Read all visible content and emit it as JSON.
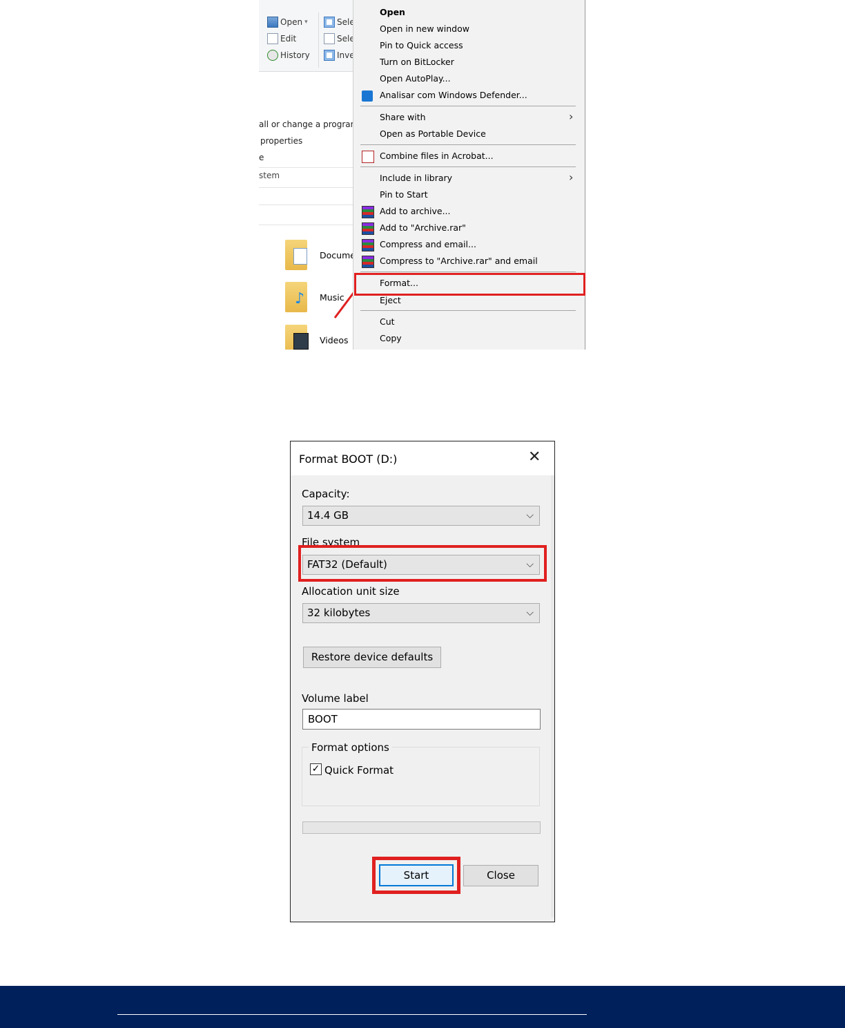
{
  "ribbon": {
    "open": "Open",
    "edit": "Edit",
    "history": "History",
    "select1": "Sele",
    "select2": "Sele",
    "invert": "Inve"
  },
  "left_links": [
    "all or change a program",
    "properties",
    "e",
    "stem"
  ],
  "folders": [
    {
      "name": "Docume",
      "icon": "documents-folder-icon"
    },
    {
      "name": "Music",
      "icon": "music-folder-icon"
    },
    {
      "name": "Videos",
      "icon": "videos-folder-icon"
    }
  ],
  "context_menu": {
    "open": "Open",
    "open_new_window": "Open in new window",
    "pin_quick": "Pin to Quick access",
    "bitlocker": "Turn on BitLocker",
    "autoplay": "Open AutoPlay...",
    "defender": "Analisar com Windows Defender...",
    "share_with": "Share with",
    "portable": "Open as Portable Device",
    "acrobat": "Combine files in Acrobat...",
    "include_library": "Include in library",
    "pin_start": "Pin to Start",
    "add_archive": "Add to archive...",
    "add_archive_rar": "Add to \"Archive.rar\"",
    "compress_email": "Compress and email...",
    "compress_rar_email": "Compress to \"Archive.rar\" and email",
    "format": "Format...",
    "eject": "Eject",
    "cut": "Cut",
    "copy": "Copy"
  },
  "dialog": {
    "title": "Format BOOT (D:)",
    "capacity_label": "Capacity:",
    "capacity_value": "14.4 GB",
    "fs_label": "File system",
    "fs_value": "FAT32 (Default)",
    "alloc_label": "Allocation unit size",
    "alloc_value": "32 kilobytes",
    "restore_button": "Restore device defaults",
    "volume_label": "Volume label",
    "volume_value": "BOOT",
    "format_options": "Format options",
    "quick_format": "Quick Format",
    "quick_format_checked": true,
    "progress": 0,
    "start_button": "Start",
    "close_button": "Close"
  },
  "colors": {
    "highlight": "#e02020",
    "footer": "#00205b",
    "focus_blue": "#0078d7"
  }
}
